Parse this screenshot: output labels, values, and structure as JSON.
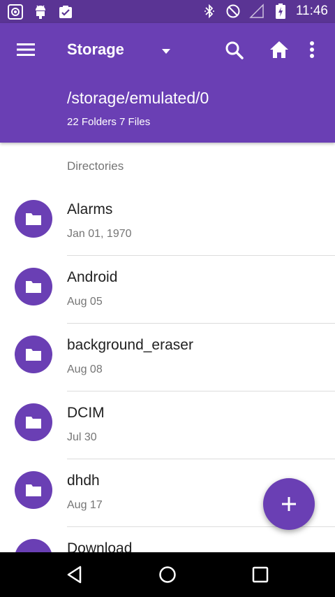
{
  "status_bar": {
    "time": "11:46",
    "left_icons": [
      "target-icon",
      "android-icon",
      "clipboard-check-icon"
    ],
    "right_icons": [
      "bluetooth-icon",
      "do-not-disturb-icon",
      "signal-icon",
      "battery-icon"
    ]
  },
  "app_bar": {
    "title": "Storage",
    "path": "/storage/emulated/0",
    "summary": "22 Folders 7 Files",
    "color": "#6a3fb4"
  },
  "section_header": "Directories",
  "directories": [
    {
      "name": "Alarms",
      "date": "Jan 01, 1970"
    },
    {
      "name": "Android",
      "date": "Aug 05"
    },
    {
      "name": "background_eraser",
      "date": "Aug 08"
    },
    {
      "name": "DCIM",
      "date": "Jul 30"
    },
    {
      "name": "dhdh",
      "date": "Aug 17"
    },
    {
      "name": "Download",
      "date": ""
    }
  ],
  "fab": {
    "icon": "plus-icon"
  },
  "nav_bar": {
    "icons": [
      "back-icon",
      "home-circle-icon",
      "recents-icon"
    ]
  }
}
